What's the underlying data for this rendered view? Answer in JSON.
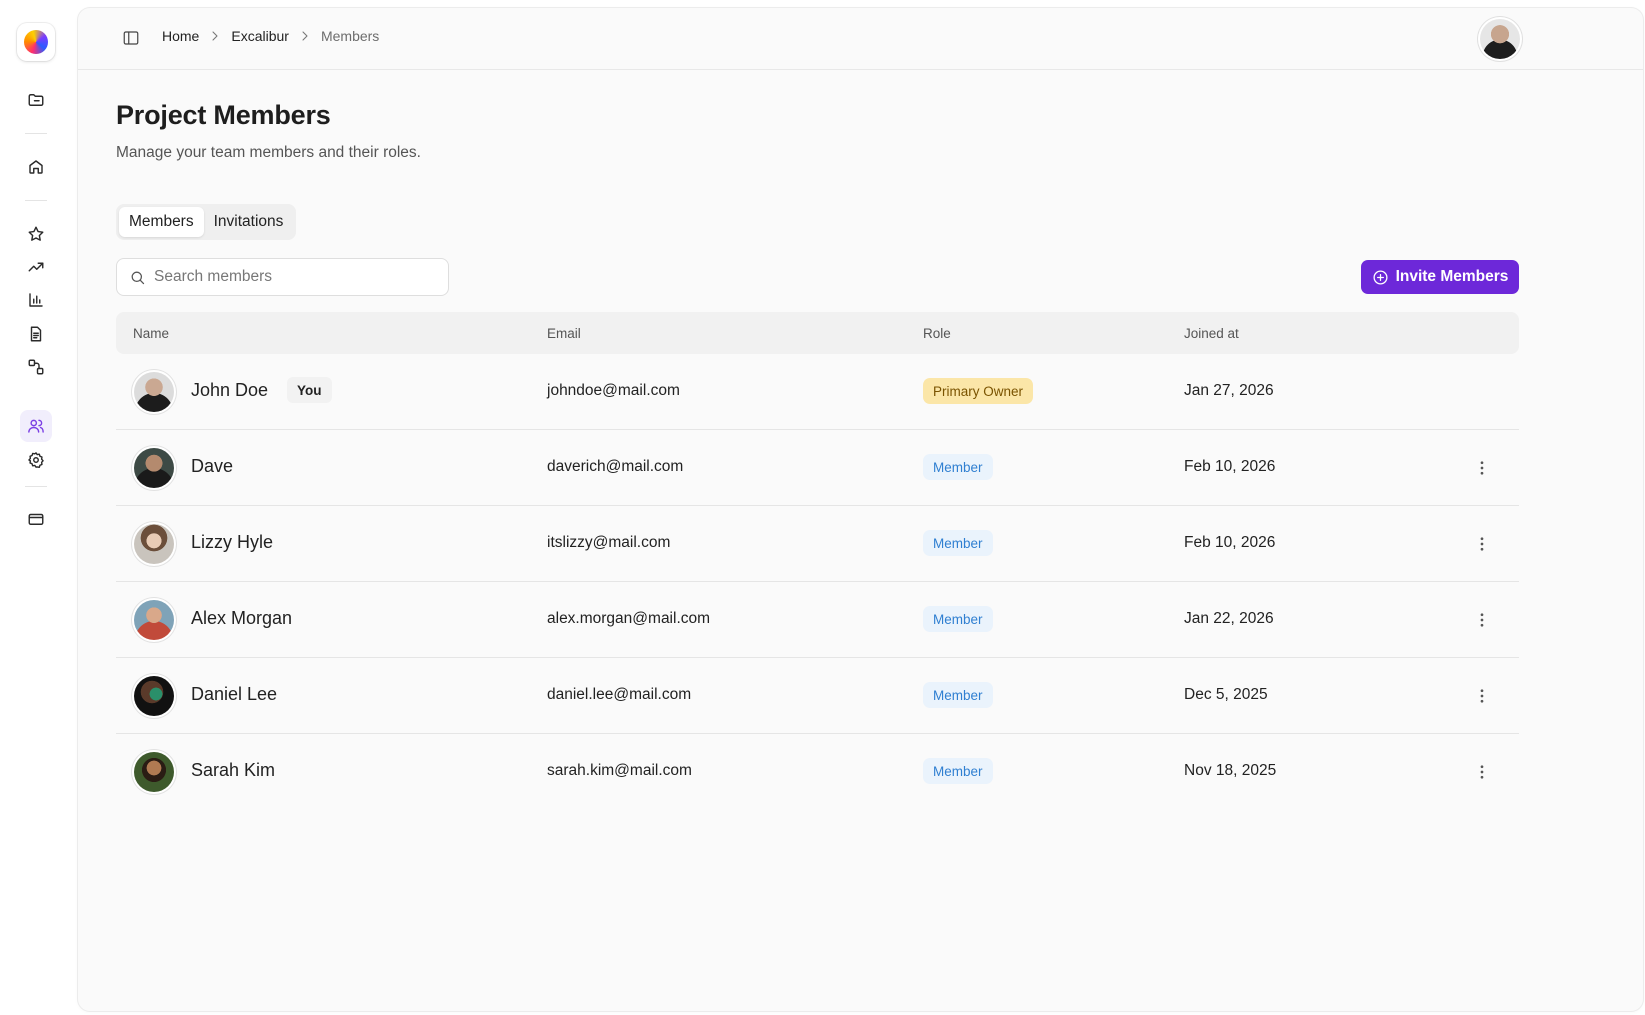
{
  "breadcrumb": [
    "Home",
    "Excalibur",
    "Members"
  ],
  "page": {
    "title": "Project Members",
    "subtitle": "Manage your team members and their roles."
  },
  "tabs": [
    {
      "label": "Members",
      "active": true
    },
    {
      "label": "Invitations",
      "active": false
    }
  ],
  "search": {
    "placeholder": "Search members",
    "value": ""
  },
  "invite_button": {
    "label": "Invite Members"
  },
  "table": {
    "columns": [
      "Name",
      "Email",
      "Role",
      "Joined at"
    ],
    "rows": [
      {
        "name": "John Doe",
        "badge": "You",
        "email": "johndoe@mail.com",
        "role": "Primary Owner",
        "joined": "Jan 27, 2026"
      },
      {
        "name": "Dave",
        "badge": "",
        "email": "daverich@mail.com",
        "role": "Member",
        "joined": "Feb 10, 2026"
      },
      {
        "name": "Lizzy Hyle",
        "badge": "",
        "email": "itslizzy@mail.com",
        "role": "Member",
        "joined": "Feb 10, 2026"
      },
      {
        "name": "Alex Morgan",
        "badge": "",
        "email": "alex.morgan@mail.com",
        "role": "Member",
        "joined": "Jan 22, 2026"
      },
      {
        "name": "Daniel Lee",
        "badge": "",
        "email": "daniel.lee@mail.com",
        "role": "Member",
        "joined": "Dec 5, 2025"
      },
      {
        "name": "Sarah Kim",
        "badge": "",
        "email": "sarah.kim@mail.com",
        "role": "Member",
        "joined": "Nov 18, 2025"
      }
    ]
  },
  "colors": {
    "accent": "#6d28d9",
    "owner_badge_bg": "#fbe6a8",
    "member_badge_bg": "#eaf3fc",
    "member_badge_text": "#2f7fd1"
  },
  "sidebar": {
    "icons": [
      "folder-icon",
      "home-icon",
      "star-icon",
      "trending-up-icon",
      "bar-chart-icon",
      "document-icon",
      "workflow-icon",
      "users-icon",
      "settings-icon",
      "credit-card-icon"
    ],
    "active": "users-icon"
  }
}
